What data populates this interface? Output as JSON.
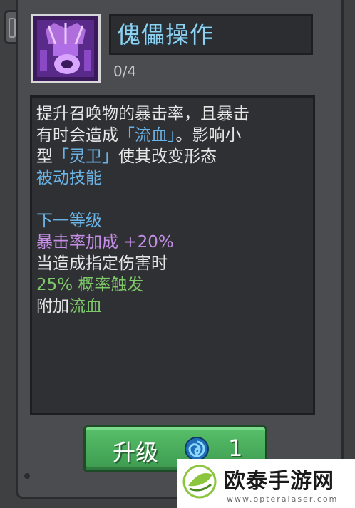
{
  "skill": {
    "name": "傀儡操作",
    "level": "0/4",
    "icon": "puppet-skill-icon"
  },
  "description": {
    "line1": "提升召唤物的暴击率，且暴击",
    "line2_pre": "有时会造成",
    "line2_highlight": "「流血」",
    "line2_post": "。影响小",
    "line3_pre": "型",
    "line3_highlight": "「灵卫」",
    "line3_post": "使其改变形态",
    "type": "被动技能"
  },
  "next_level": {
    "title": "下一等级",
    "bonus": "暴击率加成 +20%",
    "condition": "当造成指定伤害时",
    "chance": "25% 概率触发",
    "effect_pre": "附加",
    "effect_highlight": "流血"
  },
  "upgrade_button": {
    "label": "升级",
    "cost": "1",
    "currency_icon": "spiral-orb-icon"
  },
  "watermark": {
    "text": "欧泰手游网",
    "url": "www.opteralaser.com"
  },
  "colors": {
    "name_blue": "#8fd2f0",
    "highlight_blue": "#6ab3e6",
    "bonus_purple": "#c58ee6",
    "chance_green": "#7ec96a",
    "button_green": "#4cae5d"
  }
}
